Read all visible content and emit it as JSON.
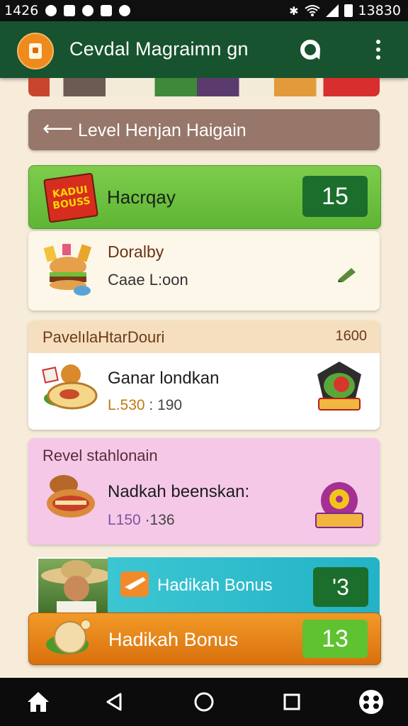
{
  "status_bar": {
    "time_left": "1426",
    "time_right": "13830"
  },
  "app_bar": {
    "title": "Cevdal Magraimn gn"
  },
  "back_bar": {
    "label": "Level Henjan Haigain"
  },
  "header_card": {
    "title": "Hacrqay",
    "badge": "15",
    "logo_text": "KADUI BOUSS"
  },
  "info_card": {
    "title": "Doralby",
    "subtitle": "Caae L:oon"
  },
  "section_one": {
    "title": "PavelılaHtarDouri",
    "count": "1600",
    "item_title": "Ganar londkan",
    "item_meta_a": "L.530",
    "item_meta_b": ": 190"
  },
  "section_two": {
    "title": "Revel stahlonain",
    "item_title": "Nadkah beenskan:",
    "item_meta_a": "L150",
    "item_meta_b": "·136"
  },
  "bonus_teal": {
    "label": "Hadikah Bonus",
    "badge": "'3"
  },
  "bonus_orange": {
    "label": "Hadikah Bonus",
    "badge": "13"
  },
  "colors": {
    "app_bar": "#17532f",
    "green_header": "#6cc23f",
    "badge_dark_green": "#1b6e2c",
    "pink_section": "#f5c8e8",
    "orange_bar": "#e8841a",
    "teal_bar": "#30bfcf"
  },
  "icons": [
    "wifi-icon",
    "battery-icon",
    "bluetooth-icon",
    "refresh-icon",
    "more-vert-icon",
    "back-arrow-icon",
    "edit-icon",
    "home-icon",
    "back-icon",
    "circle-home-icon",
    "recents-icon",
    "assistant-icon"
  ]
}
